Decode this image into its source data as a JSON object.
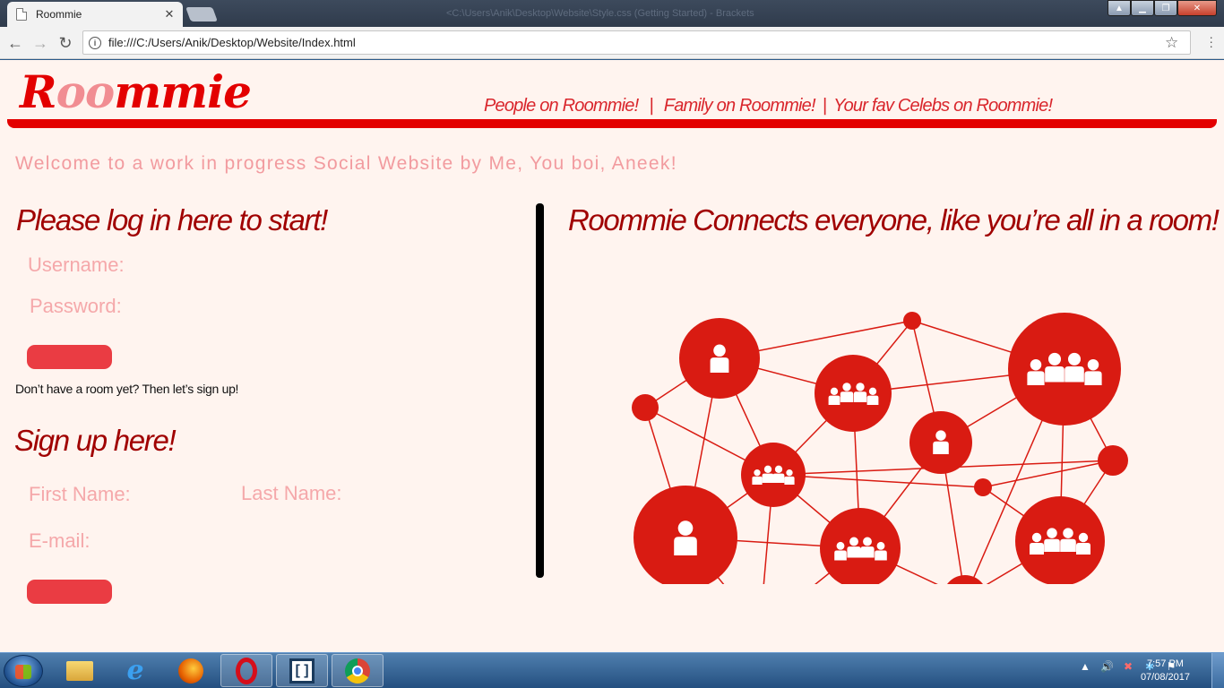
{
  "browser": {
    "tab_title": "Roommie",
    "tab_close": "✕",
    "window_title": "<C:\\Users\\Anik\\Desktop\\Website\\Style.css (Getting Started) - Brackets",
    "url": "file:///C:/Users/Anik/Desktop/Website/Index.html",
    "back": "←",
    "forward": "→",
    "reload": "↻",
    "star": "☆"
  },
  "site": {
    "logo_part1": "R",
    "logo_part2": "oo",
    "logo_part3": "mmie",
    "nav": {
      "people": "People on Roommie!",
      "family": "Family on Roommie!",
      "celebs": "Your fav Celebs on Roommie!"
    },
    "welcome": "Welcome to a work in progress Social Website by Me, You boi, Aneek!"
  },
  "login": {
    "heading": "Please log in here to start!",
    "username_label": "Username:",
    "password_label": "Password:",
    "signup_prompt": "Don’t have a room yet? Then let’s sign up!"
  },
  "signup": {
    "heading": "Sign up here!",
    "first_name_label": "First Name:",
    "last_name_label": "Last Name:",
    "email_label": "E-mail:"
  },
  "right": {
    "heading": "Roommie Connects everyone, like you’re all in a room!"
  },
  "colors": {
    "brand_red": "#e30000",
    "network_red": "#d91b12",
    "page_bg": "#fff4ef"
  },
  "taskbar": {
    "time": "7:57 PM",
    "date": "07/08/2017",
    "apps": [
      "file-explorer-icon",
      "internet-explorer-icon",
      "firefox-icon",
      "opera-icon",
      "brackets-icon",
      "chrome-icon"
    ]
  }
}
